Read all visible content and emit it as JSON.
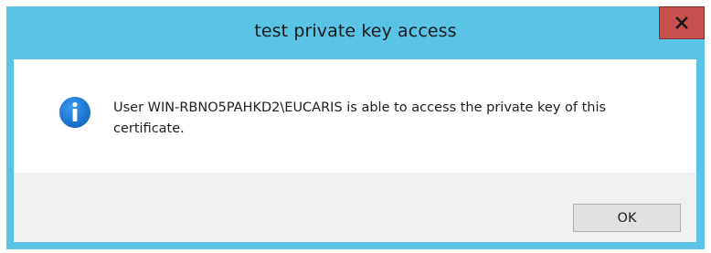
{
  "window": {
    "title": "test private key access"
  },
  "titlebar": {
    "close_icon": "close-icon",
    "close_color": "#c7504c"
  },
  "message": {
    "icon": "info-icon",
    "icon_color": "#1e7ad8",
    "text": "User WIN-RBNO5PAHKD2\\EUCARIS is able to access the private key of this certificate."
  },
  "buttons": {
    "ok_label": "OK"
  },
  "colors": {
    "frame": "#5bc3e6",
    "footer": "#f0f0f0"
  }
}
